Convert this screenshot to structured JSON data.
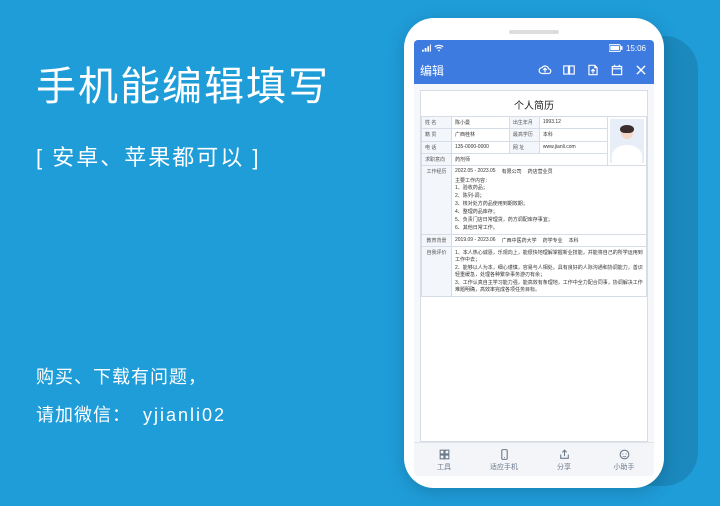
{
  "promo": {
    "headline": "手机能编辑填写",
    "subhead": "[ 安卓、苹果都可以 ]",
    "help_line1": "购买、下载有问题，",
    "help_line2_prefix": "请加微信：",
    "wechat_id": "yjianli02"
  },
  "phone": {
    "status": {
      "time": "15:06",
      "battery": "⚡"
    },
    "appbar": {
      "edit": "编辑",
      "icons": {
        "cloud": "cloud-upload-icon",
        "book": "book-icon",
        "export": "export-icon",
        "calendar": "calendar-icon",
        "close": "close-icon"
      }
    },
    "doc": {
      "title": "个人简历",
      "rows": {
        "name_lbl": "姓 名",
        "name": "陈小曼",
        "birth_lbl": "出生年月",
        "birth": "1993.12",
        "origin_lbl": "籍 贯",
        "origin": "广西桂林",
        "edu_lbl": "最高学历",
        "edu": "本科",
        "phone_lbl": "电 话",
        "phone": "135-0000-0000",
        "site_lbl": "网 址",
        "site": "www.jianli.com",
        "intent_lbl": "求职意向",
        "intent": "药剂师"
      },
      "work": {
        "side": "工作经历",
        "period": "2022.05 - 2023.05",
        "company": "有限公司",
        "role": "药店营业员",
        "duty_head": "主要工作内容：",
        "d1": "1、验收药品；",
        "d2": "2、陈列-调；",
        "d3": "3、核对处方药品使用到期效期；",
        "d4": "4、整理药品库存；",
        "d5": "5、负责门店日常理货，药方调配库存事宜；",
        "d6": "6、其他日常工作。"
      },
      "edu_sec": {
        "side": "教育背景",
        "period": "2019.09 - 2023.06",
        "school": "广西中医药大学",
        "major": "药学专业",
        "degree": "本科"
      },
      "eval": {
        "side": "自我评价",
        "p1": "1、本人热心诚恳，乐观向上，能很快地理解掌握新业技能，并能将自己的所学运用到工作中去；",
        "p2": "2、能够以人为本，细心谨慎，容易与人相处。具有良好的人际沟通和协调能力，善识轻重缓急，处理各种繁杂事务游刃有余；",
        "p3": "3、工作认真自主学习能力强，能高效有条理地，工作中全力配合同事，协调解决工作难题明确，高效率完成各项任务目标。"
      }
    },
    "bottombar": {
      "tools": "工具",
      "adapt": "适应手机",
      "share": "分享",
      "helper": "小助手"
    }
  }
}
